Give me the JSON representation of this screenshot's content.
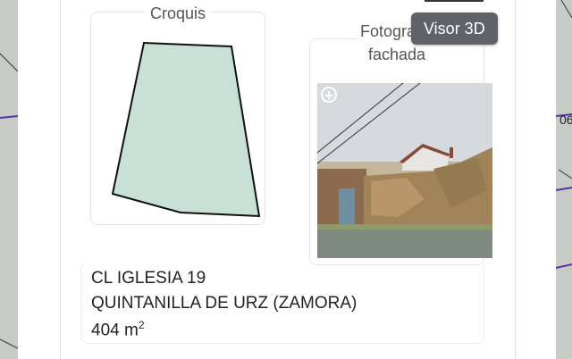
{
  "tooltip": {
    "text": "Visor 3D"
  },
  "sketch": {
    "title": "Croquis"
  },
  "photo": {
    "title_line1": "Fotografía",
    "title_line2": "fachada"
  },
  "parcel": {
    "street": "CL IGLESIA 19",
    "locality": "QUINTANILLA DE URZ (ZAMORA)",
    "area_value": "404 m",
    "area_unit_exp": "2"
  },
  "map_labels": {
    "right_edge_text": "06"
  },
  "colors": {
    "parcel_fill": "#c8e0d6",
    "tooltip_bg": "#5f6368",
    "map_line": "#5b2fa8"
  }
}
